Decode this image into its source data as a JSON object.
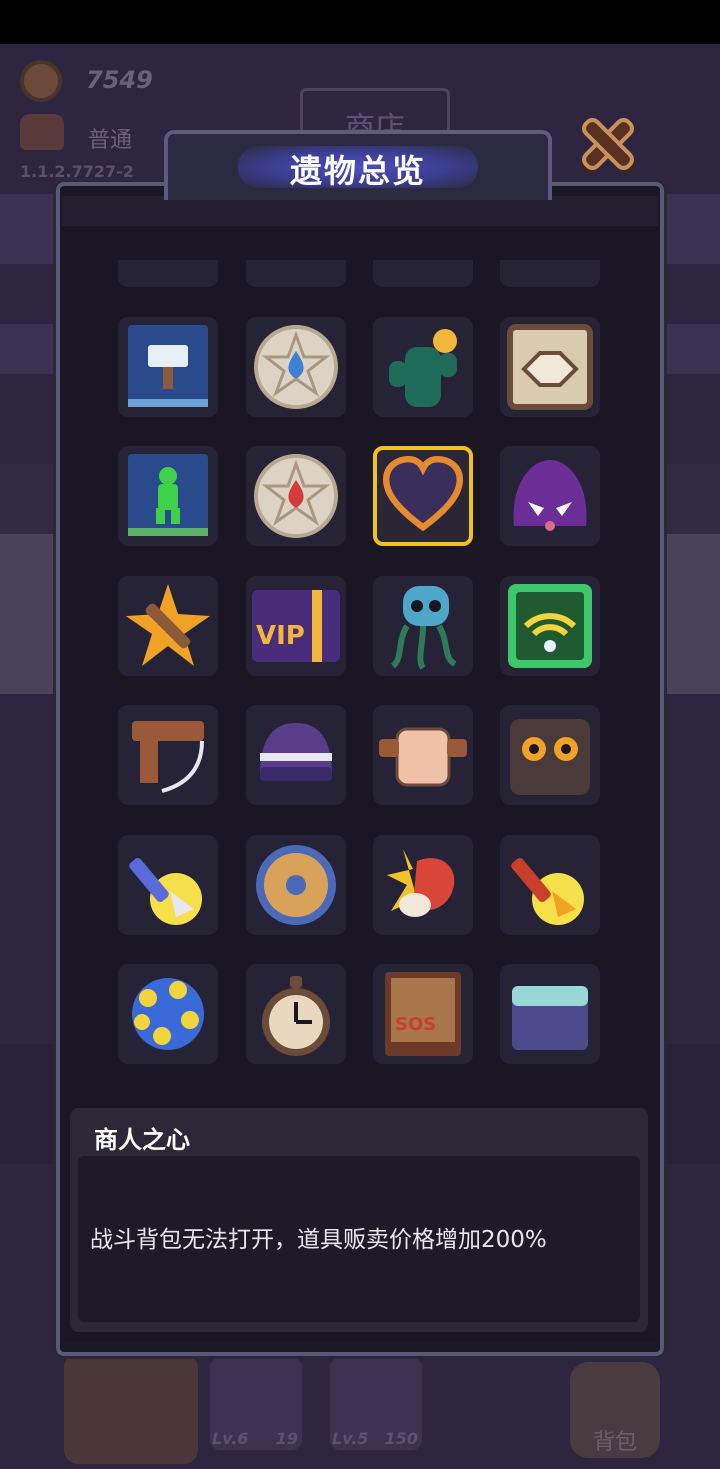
{
  "background": {
    "gold": "7549",
    "mode": "普通",
    "version": "1.1.2.7727-2",
    "shop_label": "商店",
    "slots": [
      {
        "level": "Lv.6",
        "count": "19"
      },
      {
        "level": "Lv.5",
        "count": "150"
      }
    ],
    "bag_label": "背包"
  },
  "dialog": {
    "title": "遗物总览",
    "close_icon": "close-x-icon",
    "relics": [
      {
        "name": "partial-top-1",
        "icon": "relic-icon"
      },
      {
        "name": "partial-top-2",
        "icon": "relic-icon"
      },
      {
        "name": "partial-top-3",
        "icon": "relic-icon"
      },
      {
        "name": "partial-top-4",
        "icon": "relic-icon"
      },
      {
        "name": "hammer-card",
        "icon": "hammer-card-icon"
      },
      {
        "name": "blue-rune",
        "icon": "blue-drop-rune-icon"
      },
      {
        "name": "cactus-coin",
        "icon": "cactus-icon"
      },
      {
        "name": "handshake",
        "icon": "handshake-icon"
      },
      {
        "name": "green-soldier-card",
        "icon": "soldier-card-icon"
      },
      {
        "name": "red-rune",
        "icon": "red-drop-rune-icon"
      },
      {
        "name": "merchant-heart",
        "icon": "heart-icon",
        "selected": true
      },
      {
        "name": "purple-hood",
        "icon": "hood-mask-icon"
      },
      {
        "name": "crossed-hammer",
        "icon": "star-hammer-icon"
      },
      {
        "name": "vip-card",
        "icon": "vip-card-icon",
        "text": "VIP"
      },
      {
        "name": "tentacle-skull",
        "icon": "skull-icon"
      },
      {
        "name": "wifi-box",
        "icon": "wifi-icon"
      },
      {
        "name": "wooden-bow",
        "icon": "bow-icon"
      },
      {
        "name": "striped-hat",
        "icon": "hat-icon"
      },
      {
        "name": "fist",
        "icon": "fist-icon"
      },
      {
        "name": "owl-box",
        "icon": "owl-icon"
      },
      {
        "name": "arrow-coin",
        "icon": "arrow-icon"
      },
      {
        "name": "round-shield",
        "icon": "shield-icon"
      },
      {
        "name": "meat",
        "icon": "meat-icon"
      },
      {
        "name": "gold-arrow-coin",
        "icon": "gold-arrow-icon"
      },
      {
        "name": "spiked-orb",
        "icon": "orb-icon"
      },
      {
        "name": "pocket-watch",
        "icon": "watch-icon"
      },
      {
        "name": "sos-book",
        "icon": "book-icon",
        "text": "SOS"
      },
      {
        "name": "stone-block",
        "icon": "block-icon"
      }
    ],
    "selected": {
      "name": "商人之心",
      "description": "战斗背包无法打开，道具贩卖价格增加200%"
    }
  }
}
